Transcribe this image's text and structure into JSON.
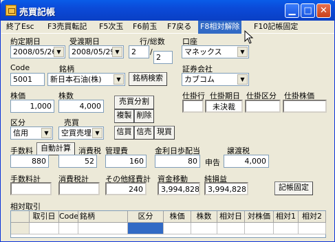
{
  "window": {
    "title": "売買記帳"
  },
  "menu": [
    "終了Esc",
    "F3売買転記",
    "F5次玉",
    "F6前玉",
    "F7戻る",
    "F8相対解除",
    "F10記帳固定"
  ],
  "labels": {
    "contract_date": "約定期日",
    "settle_date": "受渡期日",
    "line_total": "行/総数",
    "account": "口座",
    "code": "Code",
    "brand": "銘柄",
    "broker": "証券会社",
    "price": "株価",
    "shares": "株数",
    "pending_row": "仕掛行",
    "pending_date": "仕掛期日",
    "pending_kind": "仕掛区分",
    "pending_price": "仕掛株価",
    "kubun": "区分",
    "baibai": "売買",
    "fee": "手数料",
    "tax": "消費税",
    "mgmt": "管理費",
    "interest": "金利日歩配当",
    "transfer_tax": "譲渡税",
    "fee_total": "手数料計",
    "tax_total": "消費税計",
    "other_total": "その他経費計",
    "funds": "資金移動",
    "net": "純損益",
    "relative": "相対取引"
  },
  "values": {
    "contract_date": "2008/05/26",
    "settle_date": "2008/05/29",
    "line": "2",
    "total": "2",
    "account": "マネックス",
    "code": "5001",
    "brand": "新日本石油(株)",
    "broker": "カブコム",
    "price": "1,000",
    "shares": "4,000",
    "pending_row": "",
    "pending_date": "未決裁",
    "pending_kind": "",
    "pending_price": "",
    "kubun": "信用",
    "baibai": "空買売埋",
    "fee": "880",
    "tax": "52",
    "mgmt": "160",
    "interest": "80",
    "declare": "申告",
    "transfer_tax": "4,000",
    "other_total": "240",
    "funds": "3,994,828",
    "net": "3,994,828"
  },
  "buttons": {
    "brand_search": "銘柄検索",
    "split": "売買分割",
    "copy": "複製",
    "delete": "削除",
    "auto_calc": "自動計算",
    "shin_buy": "信買",
    "shin_sell": "信売",
    "genbai": "現買",
    "fix": "記帳固定"
  },
  "grid": {
    "headers": [
      "",
      "取引日",
      "Code",
      "銘柄",
      "区分",
      "株価",
      "株数",
      "相対日",
      "対株価",
      "相対1",
      "相対2"
    ]
  }
}
